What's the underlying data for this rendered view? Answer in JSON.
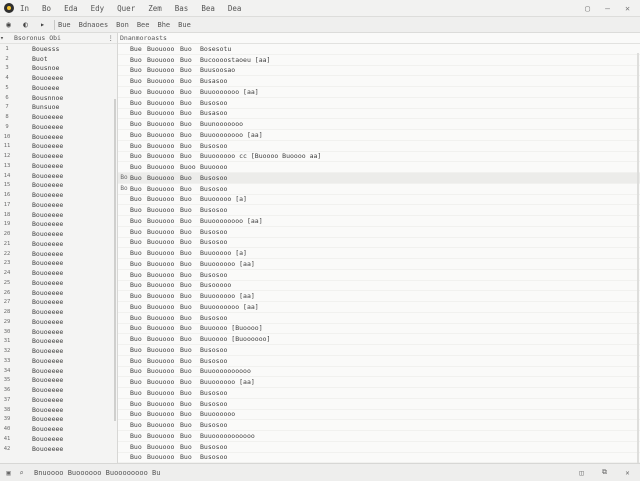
{
  "menu": {
    "items": [
      "In",
      "Bo",
      "Eda",
      "Edy",
      "Quer",
      "Zem",
      "Bas",
      "Bea",
      "Dea"
    ]
  },
  "toolbar": {
    "items": [
      "Bue",
      "Bdnaoes",
      "Bon",
      "Bee",
      "Bhe",
      "Bue"
    ]
  },
  "left_panel": {
    "header": "Bsoronus Obi",
    "items": [
      {
        "num": "1",
        "name": "Bouesss"
      },
      {
        "num": "2",
        "name": "Buot"
      },
      {
        "num": "3",
        "name": "Bousnoe"
      },
      {
        "num": "4",
        "name": "Bouoeeee"
      },
      {
        "num": "5",
        "name": "Bouoeee"
      },
      {
        "num": "6",
        "name": "Bousnnoe"
      },
      {
        "num": "7",
        "name": "Bunsuoe"
      },
      {
        "num": "8",
        "name": "Bouoeeee"
      },
      {
        "num": "9",
        "name": "Bouoeeee"
      },
      {
        "num": "10",
        "name": "Bouoeeee"
      },
      {
        "num": "11",
        "name": "Bouoeeee"
      },
      {
        "num": "12",
        "name": "Bouoeeee"
      },
      {
        "num": "13",
        "name": "Bouoeeee"
      },
      {
        "num": "14",
        "name": "Bouoeeee"
      },
      {
        "num": "15",
        "name": "Bouoeeee"
      },
      {
        "num": "16",
        "name": "Bouoeeee"
      },
      {
        "num": "17",
        "name": "Bouoeeee"
      },
      {
        "num": "18",
        "name": "Bouoeeee"
      },
      {
        "num": "19",
        "name": "Bouoeeee"
      },
      {
        "num": "20",
        "name": "Bouoeeee"
      },
      {
        "num": "21",
        "name": "Bouoeeee"
      },
      {
        "num": "22",
        "name": "Bouoeeee"
      },
      {
        "num": "23",
        "name": "Bouoeeee"
      },
      {
        "num": "24",
        "name": "Bouoeeee"
      },
      {
        "num": "25",
        "name": "Bouoeeee"
      },
      {
        "num": "26",
        "name": "Bouoeeee"
      },
      {
        "num": "27",
        "name": "Bouoeeee"
      },
      {
        "num": "28",
        "name": "Bouoeeee"
      },
      {
        "num": "29",
        "name": "Bouoeeee"
      },
      {
        "num": "30",
        "name": "Bouoeeee"
      },
      {
        "num": "31",
        "name": "Bouoeeee"
      },
      {
        "num": "32",
        "name": "Bouoeeee"
      },
      {
        "num": "33",
        "name": "Bouoeeee"
      },
      {
        "num": "34",
        "name": "Bouoeeee"
      },
      {
        "num": "35",
        "name": "Bouoeeee"
      },
      {
        "num": "36",
        "name": "Bouoeeee"
      },
      {
        "num": "37",
        "name": "Bouoeeee"
      },
      {
        "num": "38",
        "name": "Bouoeeee"
      },
      {
        "num": "39",
        "name": "Bouoeeee"
      },
      {
        "num": "40",
        "name": "Bouoeeee"
      },
      {
        "num": "41",
        "name": "Bouoeeee"
      },
      {
        "num": "42",
        "name": "Bouoeeee"
      }
    ]
  },
  "right_panel": {
    "header": "Dnanmoroasts",
    "rows": [
      {
        "marker": "",
        "c1": "Bue",
        "c2": "Buouooo",
        "c3": "Buo",
        "c4": "Bosesotu"
      },
      {
        "marker": "",
        "c1": "Buo",
        "c2": "Buouooo",
        "c3": "Buo",
        "c4": "Bucoooostaoeu [aa]"
      },
      {
        "marker": "",
        "c1": "Buo",
        "c2": "Buouooo",
        "c3": "Buo",
        "c4": "Buusoosao"
      },
      {
        "marker": "",
        "c1": "Buo",
        "c2": "Buouooo",
        "c3": "Buo",
        "c4": "Busasoo"
      },
      {
        "marker": "",
        "c1": "Buo",
        "c2": "Buouooo",
        "c3": "Buo",
        "c4": "Buuooooooo [aa]"
      },
      {
        "marker": "",
        "c1": "Buo",
        "c2": "Buouooo",
        "c3": "Buo",
        "c4": "Busosoo"
      },
      {
        "marker": "",
        "c1": "Buo",
        "c2": "Buouooo",
        "c3": "Buo",
        "c4": "Busasoo"
      },
      {
        "marker": "",
        "c1": "Buo",
        "c2": "Buouooo",
        "c3": "Buo",
        "c4": "Buunooooooo"
      },
      {
        "marker": "",
        "c1": "Buo",
        "c2": "Buouooo",
        "c3": "Buo",
        "c4": "Buuoooooooo [aa]"
      },
      {
        "marker": "",
        "c1": "Buo",
        "c2": "Buouooo",
        "c3": "Buo",
        "c4": "Busosoo"
      },
      {
        "marker": "",
        "c1": "Buo",
        "c2": "Buouooo",
        "c3": "Buo",
        "c4": "Buuoooooo cc [Buoooo Buoooo aa]"
      },
      {
        "marker": "",
        "c1": "Buo",
        "c2": "Buouooo",
        "c3": "Buoo",
        "c4": "Buuoooo"
      },
      {
        "marker": "Bo",
        "c1": "Buo",
        "c2": "Buouooo",
        "c3": "Buo",
        "c4": "Busosoo"
      },
      {
        "marker": "Bo",
        "c1": "Buo",
        "c2": "Buouooo",
        "c3": "Buo",
        "c4": "Busosoo"
      },
      {
        "marker": "",
        "c1": "Buo",
        "c2": "Buouooo",
        "c3": "Buo",
        "c4": "Buuooooo [a]"
      },
      {
        "marker": "",
        "c1": "Buo",
        "c2": "Buouooo",
        "c3": "Buo",
        "c4": "Busosoo"
      },
      {
        "marker": "",
        "c1": "Buo",
        "c2": "Buouooo",
        "c3": "Buo",
        "c4": "Buuoooooooo [aa]"
      },
      {
        "marker": "",
        "c1": "Buo",
        "c2": "Buouooo",
        "c3": "Buo",
        "c4": "Busosoo"
      },
      {
        "marker": "",
        "c1": "Buo",
        "c2": "Buouooo",
        "c3": "Buo",
        "c4": "Busosoo"
      },
      {
        "marker": "",
        "c1": "Buo",
        "c2": "Buouooo",
        "c3": "Buo",
        "c4": "Buuooooo [a]"
      },
      {
        "marker": "",
        "c1": "Buo",
        "c2": "Buouooo",
        "c3": "Buo",
        "c4": "Buuoooooo [aa]"
      },
      {
        "marker": "",
        "c1": "Buo",
        "c2": "Buouooo",
        "c3": "Buo",
        "c4": "Busosoo"
      },
      {
        "marker": "",
        "c1": "Buo",
        "c2": "Buouooo",
        "c3": "Buo",
        "c4": "Busooooo"
      },
      {
        "marker": "",
        "c1": "Buo",
        "c2": "Buouooo",
        "c3": "Buo",
        "c4": "Buuoooooo [aa]"
      },
      {
        "marker": "",
        "c1": "Buo",
        "c2": "Buouooo",
        "c3": "Buo",
        "c4": "Buuooooooo [aa]"
      },
      {
        "marker": "",
        "c1": "Buo",
        "c2": "Buouooo",
        "c3": "Buo",
        "c4": "Busosoo"
      },
      {
        "marker": "",
        "c1": "Buo",
        "c2": "Buouooo",
        "c3": "Buo",
        "c4": "Buuoooo [Buoooo]"
      },
      {
        "marker": "",
        "c1": "Buo",
        "c2": "Buouooo",
        "c3": "Buo",
        "c4": "Buuoooo [Buoooooo]"
      },
      {
        "marker": "",
        "c1": "Buo",
        "c2": "Buouooo",
        "c3": "Buo",
        "c4": "Busosoo"
      },
      {
        "marker": "",
        "c1": "Buo",
        "c2": "Buouooo",
        "c3": "Buo",
        "c4": "Busosoo"
      },
      {
        "marker": "",
        "c1": "Buo",
        "c2": "Buouooo",
        "c3": "Buo",
        "c4": "Buuoooooooooo"
      },
      {
        "marker": "",
        "c1": "Buo",
        "c2": "Buouooo",
        "c3": "Buo",
        "c4": "Buuoooooo [aa]"
      },
      {
        "marker": "",
        "c1": "Buo",
        "c2": "Buouooo",
        "c3": "Buo",
        "c4": "Busosoo"
      },
      {
        "marker": "",
        "c1": "Buo",
        "c2": "Buouooo",
        "c3": "Buo",
        "c4": "Busosoo"
      },
      {
        "marker": "",
        "c1": "Buo",
        "c2": "Buouooo",
        "c3": "Buo",
        "c4": "Buuoooooo"
      },
      {
        "marker": "",
        "c1": "Buo",
        "c2": "Buouooo",
        "c3": "Buo",
        "c4": "Busosoo"
      },
      {
        "marker": "",
        "c1": "Buo",
        "c2": "Buouooo",
        "c3": "Buo",
        "c4": "Buuooooooooooo"
      },
      {
        "marker": "",
        "c1": "Buo",
        "c2": "Buouooo",
        "c3": "Buo",
        "c4": "Busosoo"
      },
      {
        "marker": "",
        "c1": "Buo",
        "c2": "Buouooo",
        "c3": "Buo",
        "c4": "Busosoo"
      },
      {
        "marker": "",
        "c1": "Buo",
        "c2": "Buouooo",
        "c3": "Buo",
        "c4": "Busosoo"
      },
      {
        "marker": "",
        "c1": "Buo",
        "c2": "Buouooo",
        "c3": "Buo",
        "c4": "Busosoo"
      },
      {
        "marker": "",
        "c1": "Buo",
        "c2": "Buouooo",
        "c3": "Buo",
        "c4": "Busosoo"
      }
    ]
  },
  "statusbar": {
    "text": "Bnuoooo Buoooooo Buoooooooo Bu",
    "right": [
      "",
      "",
      ""
    ]
  },
  "colors": {
    "accent": "#f2c230",
    "selected_row": "#ececea"
  },
  "icons": {
    "menubar_left": [
      "app-icon"
    ],
    "toolbar": [
      "back-icon",
      "forward-icon",
      "stop-icon"
    ],
    "statusbar": [
      "camera-icon",
      "filter-icon"
    ],
    "menubar_right": [
      "window-menu-icon",
      "minimize-icon",
      "close-icon"
    ]
  }
}
